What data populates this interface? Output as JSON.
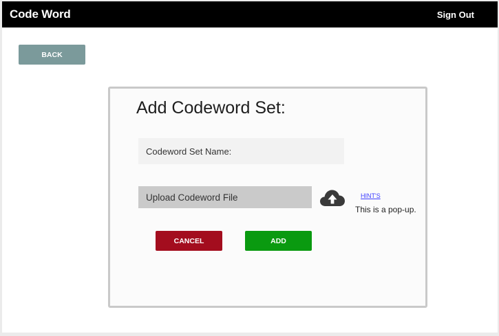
{
  "app": {
    "title": "Code Word",
    "sign_out_label": "Sign Out"
  },
  "nav": {
    "back_label": "BACK"
  },
  "form": {
    "title": "Add Codeword Set:",
    "name_field": {
      "placeholder": "Codeword Set Name:",
      "value": ""
    },
    "upload_label": "Upload Codeword File",
    "upload_icon": "cloud-upload-icon",
    "hint_link": "HINT'S",
    "popup_text": "This is a pop-up.",
    "cancel_label": "CANCEL",
    "add_label": "ADD"
  },
  "colors": {
    "topbar": "#000000",
    "back_button": "#7b9a9b",
    "cancel_button": "#a30d1e",
    "add_button": "#0a9a10",
    "hint_link": "#3a3aff"
  }
}
